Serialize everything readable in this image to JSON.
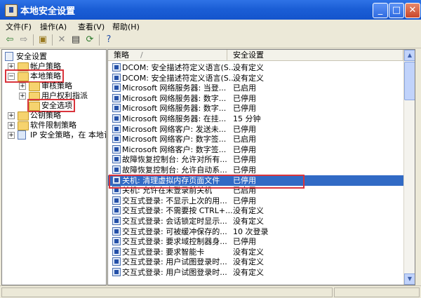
{
  "window": {
    "title": "本地安全设置"
  },
  "menu": [
    "文件(F)",
    "操作(A)",
    "查看(V)",
    "帮助(H)"
  ],
  "toolbar": {
    "icons": [
      "back-icon",
      "forward-icon",
      "up-folder-icon",
      "delete-icon",
      "properties-icon",
      "refresh-icon",
      "help-icon"
    ]
  },
  "tree": [
    {
      "label": "安全设置"
    },
    {
      "label": "帐户策略"
    },
    {
      "label": "本地策略"
    },
    {
      "label": "审核策略"
    },
    {
      "label": "用户权利指派"
    },
    {
      "label": "安全选项"
    },
    {
      "label": "公钥策略"
    },
    {
      "label": "软件限制策略"
    },
    {
      "label": "IP 安全策略，在 本地计"
    }
  ],
  "list": {
    "columns": [
      "策略",
      "安全设置"
    ],
    "rows": [
      {
        "policy": "DCOM: 安全描述符定义语言(S...",
        "setting": "没有定义"
      },
      {
        "policy": "DCOM: 安全描述符定义语言(S...",
        "setting": "没有定义"
      },
      {
        "policy": "Microsoft 网络服务器: 当登...",
        "setting": "已启用"
      },
      {
        "policy": "Microsoft 网络服务器: 数字...",
        "setting": "已停用"
      },
      {
        "policy": "Microsoft 网络服务器: 数字...",
        "setting": "已停用"
      },
      {
        "policy": "Microsoft 网络服务器: 在挂...",
        "setting": "15 分钟"
      },
      {
        "policy": "Microsoft 网络客户: 发送未...",
        "setting": "已停用"
      },
      {
        "policy": "Microsoft 网络客户: 数字签...",
        "setting": "已启用"
      },
      {
        "policy": "Microsoft 网络客户: 数字签...",
        "setting": "已停用"
      },
      {
        "policy": "故障恢复控制台: 允许对所有...",
        "setting": "已停用"
      },
      {
        "policy": "故障恢复控制台: 允许自动系...",
        "setting": "已停用"
      },
      {
        "policy": "关机: 清理虚拟内存页面文件",
        "setting": "已停用"
      },
      {
        "policy": "关机: 允许在未登录前关机",
        "setting": "已启用"
      },
      {
        "policy": "交互式登录: 不显示上次的用...",
        "setting": "已停用"
      },
      {
        "policy": "交互式登录: 不需要按 CTRL+...",
        "setting": "没有定义"
      },
      {
        "policy": "交互式登录: 会话锁定时显示...",
        "setting": "没有定义"
      },
      {
        "policy": "交互式登录: 可被缓冲保存的...",
        "setting": "10 次登录"
      },
      {
        "policy": "交互式登录: 要求域控制器身...",
        "setting": "已停用"
      },
      {
        "policy": "交互式登录: 要求智能卡",
        "setting": "没有定义"
      },
      {
        "policy": "交互式登录: 用户试图登录时...",
        "setting": "没有定义"
      },
      {
        "policy": "交互式登录: 用户试图登录时...",
        "setting": "没有定义"
      }
    ]
  },
  "colors": {
    "selection": "#316AC5",
    "highlight": "#D9343C"
  }
}
